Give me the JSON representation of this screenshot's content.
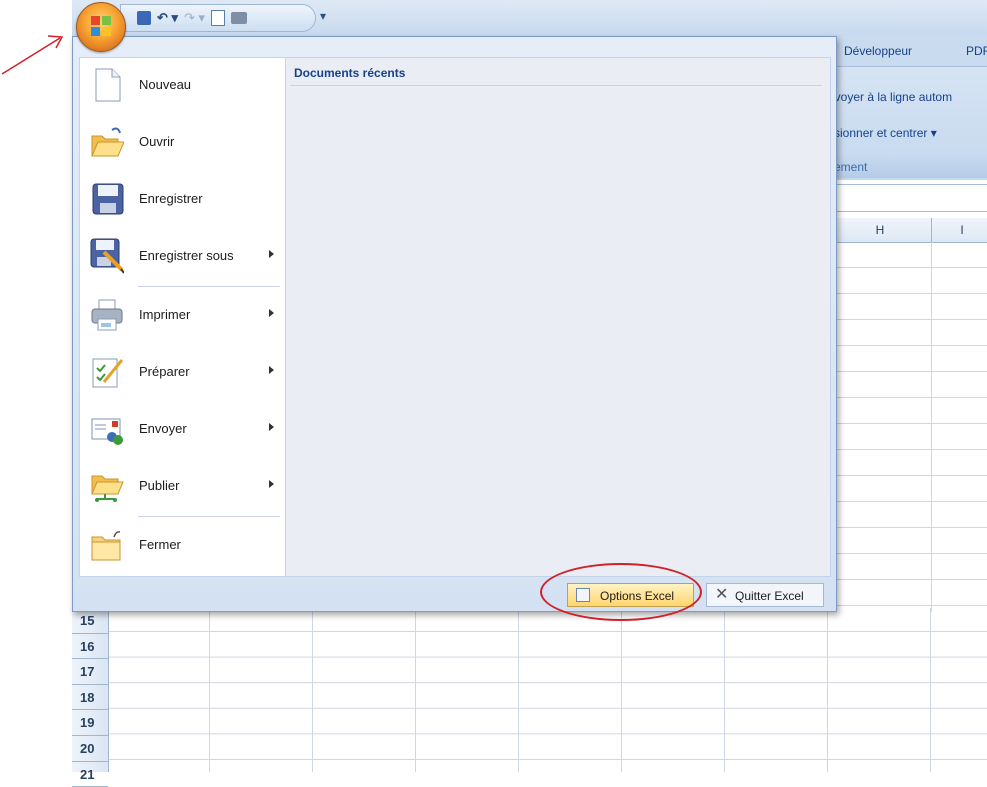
{
  "ribbon": {
    "tabs": [
      "Développeur",
      "PDF"
    ],
    "row1": "nvoyer à la ligne autom",
    "row2": "sionner et centrer ▾",
    "group_label": "ement"
  },
  "column_headers": [
    "H",
    "I"
  ],
  "row_numbers": [
    "15",
    "16",
    "17",
    "18",
    "19",
    "20",
    "21"
  ],
  "office_menu": {
    "items": [
      {
        "label": "Nouveau",
        "icon": "new-document-icon",
        "has_submenu": false
      },
      {
        "label": "Ouvrir",
        "icon": "open-folder-icon",
        "has_submenu": false
      },
      {
        "label": "Enregistrer",
        "icon": "save-disk-icon",
        "has_submenu": false
      },
      {
        "label": "Enregistrer sous",
        "icon": "save-as-icon",
        "has_submenu": true
      },
      {
        "label": "Imprimer",
        "icon": "printer-icon",
        "has_submenu": true
      },
      {
        "label": "Préparer",
        "icon": "prepare-icon",
        "has_submenu": true
      },
      {
        "label": "Envoyer",
        "icon": "send-mail-icon",
        "has_submenu": true
      },
      {
        "label": "Publier",
        "icon": "publish-icon",
        "has_submenu": true
      },
      {
        "label": "Fermer",
        "icon": "close-folder-icon",
        "has_submenu": false
      }
    ],
    "recent_documents_title": "Documents récents",
    "options_button": "Options Excel",
    "quit_button": "Quitter Excel"
  },
  "colors": {
    "annotation_red": "#d0202a",
    "ribbon_blue": "#15428b",
    "office_orange": "#f7a230"
  }
}
